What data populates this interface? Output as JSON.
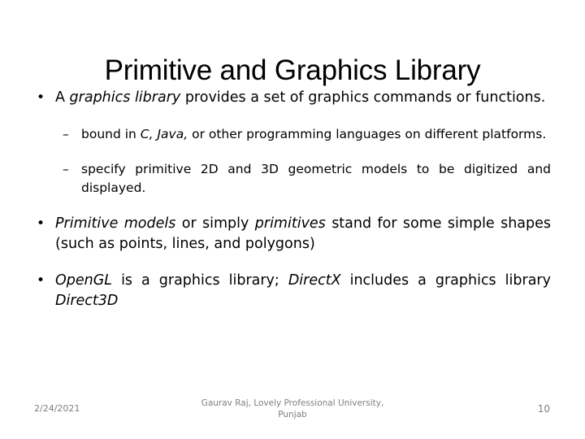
{
  "slide": {
    "title": "Primitive and Graphics Library",
    "bullets": [
      {
        "level": 1,
        "marker": "•",
        "parts": [
          {
            "text": "A ",
            "italic": false
          },
          {
            "text": "graphics library",
            "italic": true
          },
          {
            "text": " provides a set of graphics commands or functions.",
            "italic": false
          }
        ]
      },
      {
        "level": 2,
        "marker": "–",
        "parts": [
          {
            "text": "bound in ",
            "italic": false
          },
          {
            "text": "C, Java,",
            "italic": true
          },
          {
            "text": " or other programming languages on different platforms.",
            "italic": false
          }
        ]
      },
      {
        "level": 2,
        "marker": "–",
        "parts": [
          {
            "text": " specify primitive 2D and 3D geometric models to be digitized and displayed.",
            "italic": false
          }
        ]
      },
      {
        "level": 1,
        "marker": "•",
        "parts": [
          {
            "text": "Primitive models",
            "italic": true
          },
          {
            "text": " or simply ",
            "italic": false
          },
          {
            "text": "primitives",
            "italic": true
          },
          {
            "text": " stand for some simple shapes (such as points, lines, and polygons)",
            "italic": false
          }
        ]
      },
      {
        "level": 1,
        "marker": "•",
        "parts": [
          {
            "text": "OpenGL",
            "italic": true
          },
          {
            "text": " is a graphics library; ",
            "italic": false
          },
          {
            "text": "DirectX",
            "italic": true
          },
          {
            "text": " includes a graphics library ",
            "italic": false
          },
          {
            "text": "Direct3D",
            "italic": true
          }
        ]
      }
    ]
  },
  "footer": {
    "date": "2/24/2021",
    "center_line1": "Gaurav Raj, Lovely Professional University,",
    "center_line2": "Punjab",
    "page_number": "10",
    "text_color": "#7f7f7f"
  }
}
